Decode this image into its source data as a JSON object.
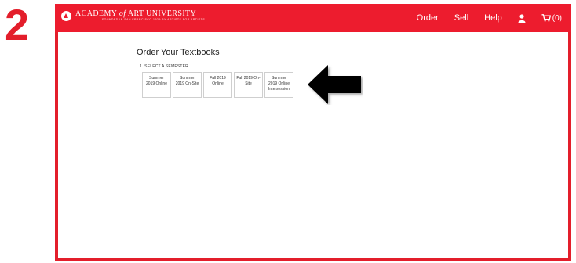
{
  "step": "2",
  "header": {
    "logo_name_pre": "ACADEMY",
    "logo_name_of": "of",
    "logo_name_post": "ART UNIVERSITY",
    "logo_tagline": "FOUNDED IN SAN FRANCISCO 1929 BY ARTISTS FOR ARTISTS",
    "nav": {
      "order": "Order",
      "sell": "Sell",
      "help": "Help",
      "cart_count": "(0)"
    }
  },
  "main": {
    "title": "Order Your Textbooks",
    "step_label": "1. SELECT A SEMESTER",
    "semesters": [
      "Summer 2019 Online",
      "Summer 2019 On-Site",
      "Fall 2019 Online",
      "Fall 2019 On-Site",
      "Summer 2019 Online Intersession"
    ]
  },
  "colors": {
    "brand_red": "#ed1c2e",
    "step_red": "#e31e2b",
    "arrow": "#000000"
  },
  "icons": {
    "user": "user-icon",
    "cart": "cart-icon",
    "logo": "aau-logo-icon",
    "arrow": "left-arrow-icon"
  }
}
